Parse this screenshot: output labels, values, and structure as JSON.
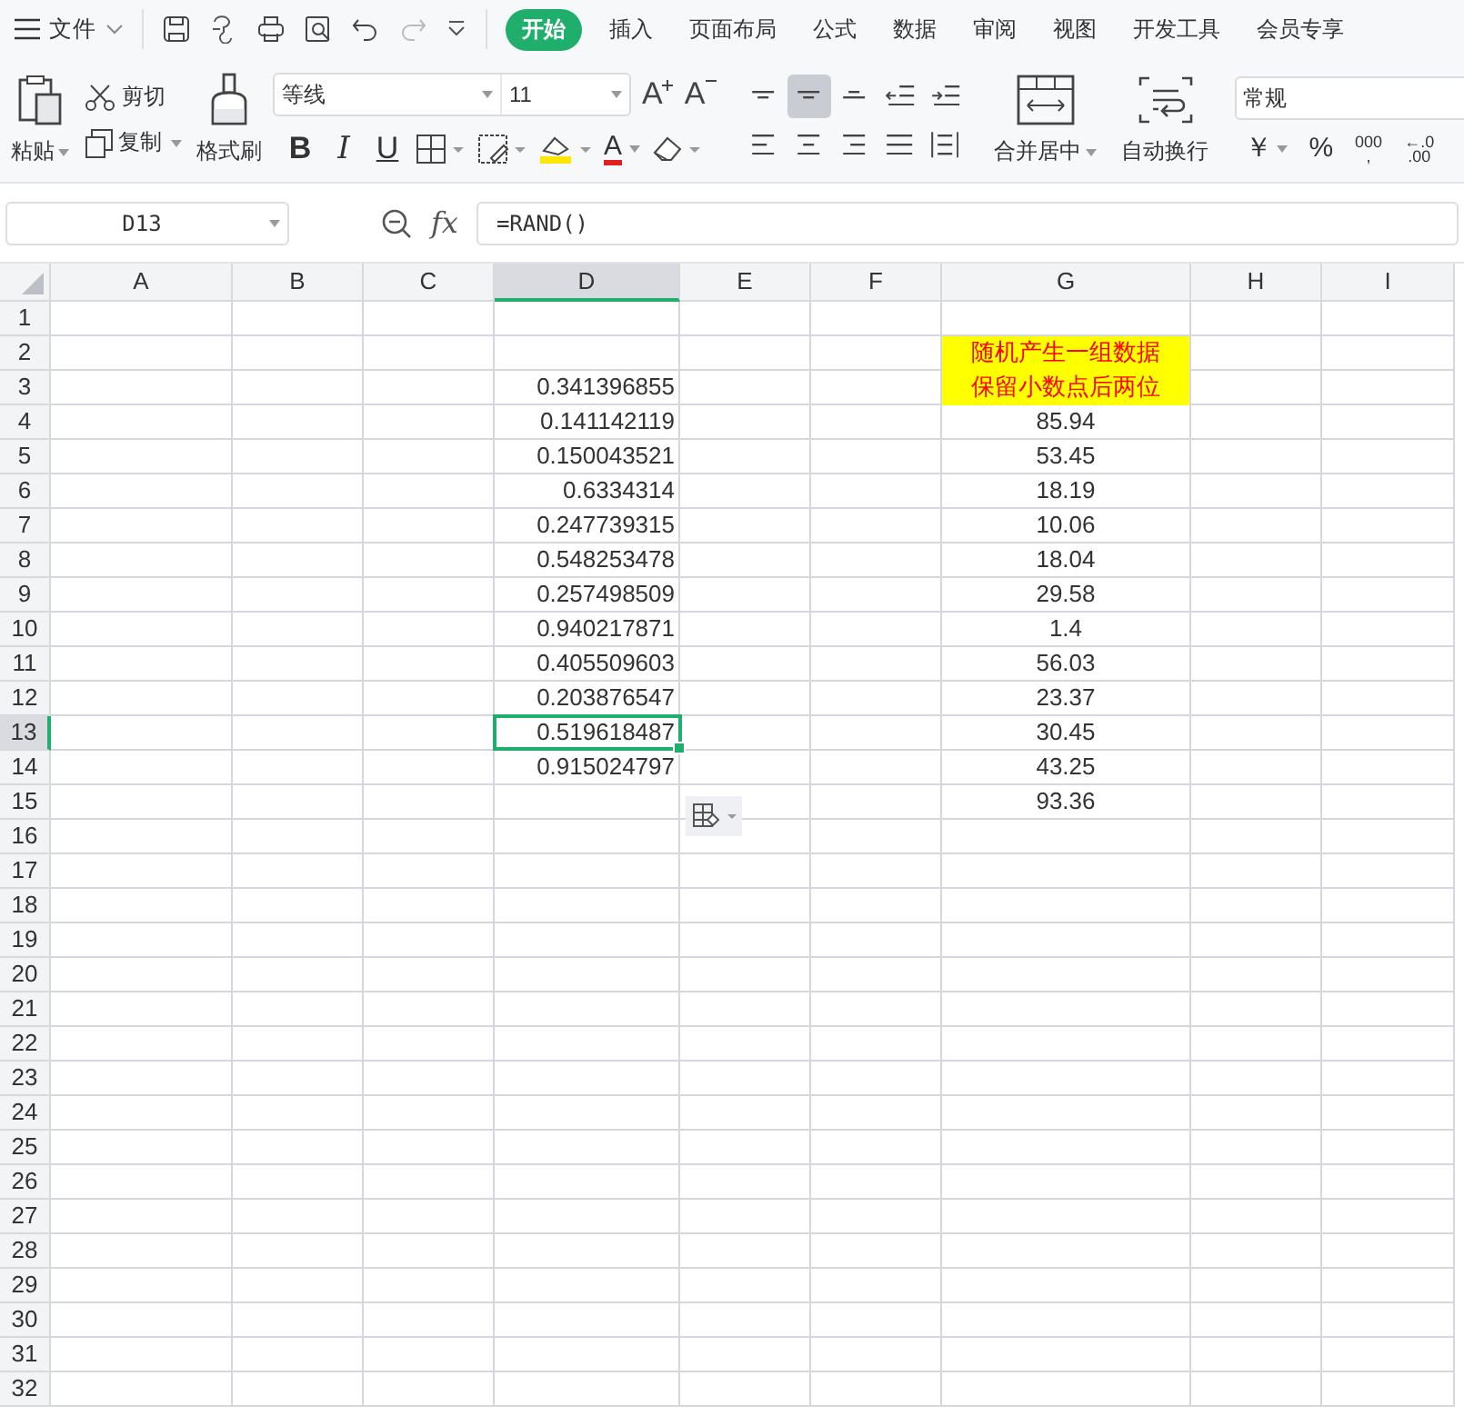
{
  "menu": {
    "label": "文件"
  },
  "tabs": [
    {
      "label": "开始",
      "selected": true
    },
    {
      "label": "插入",
      "selected": false
    },
    {
      "label": "页面布局",
      "selected": false
    },
    {
      "label": "公式",
      "selected": false
    },
    {
      "label": "数据",
      "selected": false
    },
    {
      "label": "审阅",
      "selected": false
    },
    {
      "label": "视图",
      "selected": false
    },
    {
      "label": "开发工具",
      "selected": false
    },
    {
      "label": "会员专享",
      "selected": false
    }
  ],
  "clipboard": {
    "paste": "粘贴",
    "cut": "剪切",
    "copy": "复制",
    "format_painter": "格式刷"
  },
  "font": {
    "name": "等线",
    "size": "11",
    "grow": "A",
    "shrink": "A",
    "bold": "B",
    "italic": "I",
    "underline": "U",
    "font_color": "A"
  },
  "align_buttons": [
    {
      "kind": "top",
      "selected": false
    },
    {
      "kind": "middle",
      "selected": true
    },
    {
      "kind": "bottom",
      "selected": false
    },
    {
      "kind": "outdent",
      "selected": false
    },
    {
      "kind": "indent",
      "selected": false
    },
    {
      "kind": "left",
      "selected": false
    },
    {
      "kind": "center",
      "selected": false
    },
    {
      "kind": "right",
      "selected": false
    },
    {
      "kind": "justify",
      "selected": false
    },
    {
      "kind": "distribute",
      "selected": false
    }
  ],
  "merge": {
    "label": "合并居中"
  },
  "wrap": {
    "label": "自动换行"
  },
  "number_format": {
    "value": "常规"
  },
  "number_buttons": [
    {
      "kind": "currency",
      "label": "￥"
    },
    {
      "kind": "percent",
      "label": "%"
    },
    {
      "kind": "thousands",
      "label": "000",
      "sub": ","
    },
    {
      "kind": "decimal",
      "label": "←.0",
      "sub": ".00"
    }
  ],
  "name_box": {
    "value": "D13"
  },
  "formula_bar": {
    "fx": "fx",
    "value": "=RAND()"
  },
  "columns": [
    {
      "label": "A",
      "selected": false
    },
    {
      "label": "B",
      "selected": false
    },
    {
      "label": "C",
      "selected": false
    },
    {
      "label": "D",
      "selected": true
    },
    {
      "label": "E",
      "selected": false
    },
    {
      "label": "F",
      "selected": false
    },
    {
      "label": "G",
      "selected": false
    },
    {
      "label": "H",
      "selected": false
    },
    {
      "label": "I",
      "selected": false
    }
  ],
  "rows": [
    {
      "label": "1",
      "selected": false,
      "cells": {}
    },
    {
      "label": "2",
      "selected": false,
      "cells": {
        "G": {
          "text": "随机产生一组数据",
          "kind": "note",
          "selected": false
        }
      }
    },
    {
      "label": "3",
      "selected": false,
      "cells": {
        "D": {
          "text": "0.341396855",
          "kind": "number",
          "selected": false
        },
        "G": {
          "text": "保留小数点后两位",
          "kind": "note",
          "selected": false
        }
      }
    },
    {
      "label": "4",
      "selected": false,
      "cells": {
        "D": {
          "text": "0.141142119",
          "kind": "number",
          "selected": false
        },
        "G": {
          "text": "85.94",
          "kind": "centered",
          "selected": false
        }
      }
    },
    {
      "label": "5",
      "selected": false,
      "cells": {
        "D": {
          "text": "0.150043521",
          "kind": "number",
          "selected": false
        },
        "G": {
          "text": "53.45",
          "kind": "centered",
          "selected": false
        }
      }
    },
    {
      "label": "6",
      "selected": false,
      "cells": {
        "D": {
          "text": "0.6334314",
          "kind": "number",
          "selected": false
        },
        "G": {
          "text": "18.19",
          "kind": "centered",
          "selected": false
        }
      }
    },
    {
      "label": "7",
      "selected": false,
      "cells": {
        "D": {
          "text": "0.247739315",
          "kind": "number",
          "selected": false
        },
        "G": {
          "text": "10.06",
          "kind": "centered",
          "selected": false
        }
      }
    },
    {
      "label": "8",
      "selected": false,
      "cells": {
        "D": {
          "text": "0.548253478",
          "kind": "number",
          "selected": false
        },
        "G": {
          "text": "18.04",
          "kind": "centered",
          "selected": false
        }
      }
    },
    {
      "label": "9",
      "selected": false,
      "cells": {
        "D": {
          "text": "0.257498509",
          "kind": "number",
          "selected": false
        },
        "G": {
          "text": "29.58",
          "kind": "centered",
          "selected": false
        }
      }
    },
    {
      "label": "10",
      "selected": false,
      "cells": {
        "D": {
          "text": "0.940217871",
          "kind": "number",
          "selected": false
        },
        "G": {
          "text": "1.4",
          "kind": "centered",
          "selected": false
        }
      }
    },
    {
      "label": "11",
      "selected": false,
      "cells": {
        "D": {
          "text": "0.405509603",
          "kind": "number",
          "selected": false
        },
        "G": {
          "text": "56.03",
          "kind": "centered",
          "selected": false
        }
      }
    },
    {
      "label": "12",
      "selected": false,
      "cells": {
        "D": {
          "text": "0.203876547",
          "kind": "number",
          "selected": false
        },
        "G": {
          "text": "23.37",
          "kind": "centered",
          "selected": false
        }
      }
    },
    {
      "label": "13",
      "selected": true,
      "cells": {
        "D": {
          "text": "0.519618487",
          "kind": "number",
          "selected": true
        },
        "G": {
          "text": "30.45",
          "kind": "centered",
          "selected": false
        }
      }
    },
    {
      "label": "14",
      "selected": false,
      "cells": {
        "D": {
          "text": "0.915024797",
          "kind": "number",
          "selected": false
        },
        "G": {
          "text": "43.25",
          "kind": "centered",
          "selected": false
        }
      }
    },
    {
      "label": "15",
      "selected": false,
      "cells": {
        "G": {
          "text": "93.36",
          "kind": "centered",
          "selected": false
        }
      }
    },
    {
      "label": "16",
      "selected": false,
      "cells": {}
    },
    {
      "label": "17",
      "selected": false,
      "cells": {}
    },
    {
      "label": "18",
      "selected": false,
      "cells": {}
    },
    {
      "label": "19",
      "selected": false,
      "cells": {}
    },
    {
      "label": "20",
      "selected": false,
      "cells": {}
    },
    {
      "label": "21",
      "selected": false,
      "cells": {}
    },
    {
      "label": "22",
      "selected": false,
      "cells": {}
    },
    {
      "label": "23",
      "selected": false,
      "cells": {}
    },
    {
      "label": "24",
      "selected": false,
      "cells": {}
    },
    {
      "label": "25",
      "selected": false,
      "cells": {}
    },
    {
      "label": "26",
      "selected": false,
      "cells": {}
    },
    {
      "label": "27",
      "selected": false,
      "cells": {}
    },
    {
      "label": "28",
      "selected": false,
      "cells": {}
    },
    {
      "label": "29",
      "selected": false,
      "cells": {}
    },
    {
      "label": "30",
      "selected": false,
      "cells": {}
    },
    {
      "label": "31",
      "selected": false,
      "cells": {}
    },
    {
      "label": "32",
      "selected": false,
      "cells": {}
    }
  ]
}
